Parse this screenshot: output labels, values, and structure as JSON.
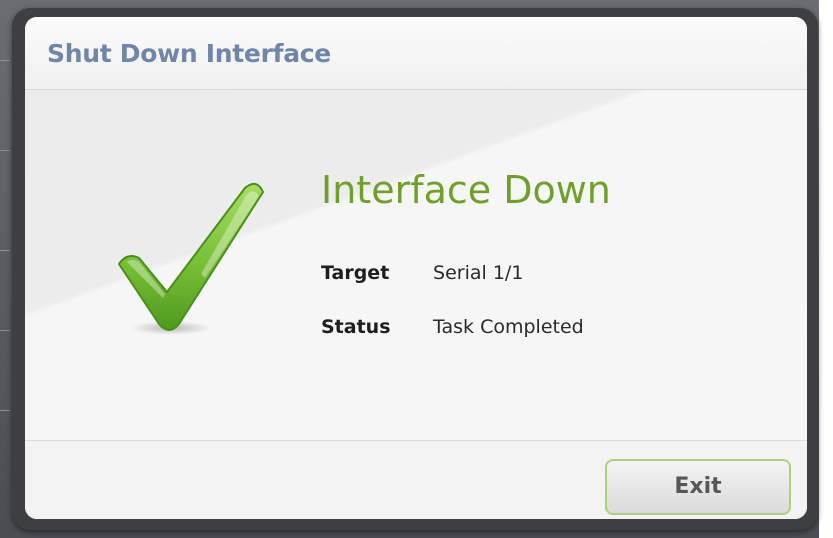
{
  "dialog": {
    "title": "Shut Down Interface",
    "headline": "Interface Down",
    "icon": "checkmark-icon",
    "fields": [
      {
        "label": "Target",
        "value": "Serial 1/1"
      },
      {
        "label": "Status",
        "value": "Task Completed"
      }
    ],
    "exit_label": "Exit"
  },
  "colors": {
    "title": "#6f86a8",
    "headline": "#6ea12c",
    "checkmark": "#7cc23a",
    "button_border": "#a8d37a",
    "frame": "#3e3f42"
  }
}
